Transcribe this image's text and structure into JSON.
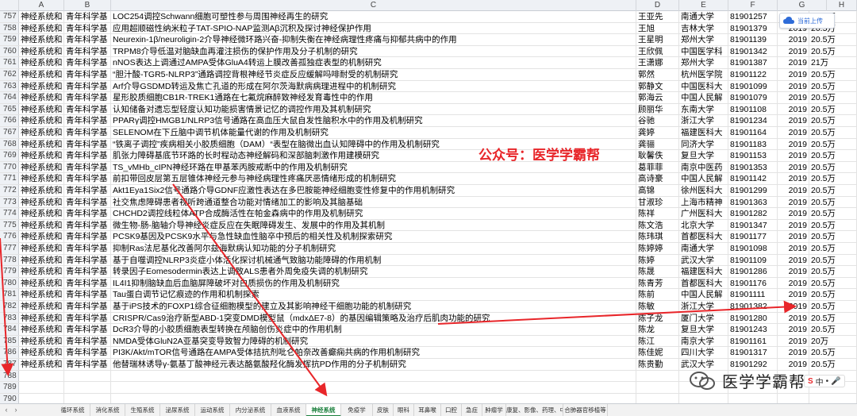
{
  "columns": [
    "A",
    "B",
    "C",
    "D",
    "E",
    "F",
    "G",
    "H"
  ],
  "rows": [
    {
      "n": "757",
      "a": "神经系统和",
      "b": "青年科学基",
      "c": "LOC254调控Schwann细胞可塑性参与周围神经再生的研究",
      "d": "王亚先",
      "e": "南通大学",
      "f": "81901257",
      "g": "2019",
      "h": "20.5万"
    },
    {
      "n": "758",
      "a": "神经系统和",
      "b": "青年科学基",
      "c": "应用超顺磁性纳米粒子TAT-SPIO-NAP监测Aβ沉积及探讨神经保护作用",
      "d": "王旭",
      "e": "吉林大学",
      "f": "81901379",
      "g": "2019",
      "h": "20.5万"
    },
    {
      "n": "759",
      "a": "神经系统和",
      "b": "青年科学基",
      "c": "Neurexin-1β/neuroligin-2介导神经微环路兴奋-抑制失衡在神经病理性疼痛与抑郁共病中的作用",
      "d": "王星明",
      "e": "郑州大学",
      "f": "81901139",
      "g": "2019",
      "h": "20.5万"
    },
    {
      "n": "760",
      "a": "神经系统和",
      "b": "青年科学基",
      "c": "TRPM8介导低温对脑缺血再灌注损伤的保护作用及分子机制的研究",
      "d": "王欣佩",
      "e": "中国医学科",
      "f": "81901342",
      "g": "2019",
      "h": "20.5万"
    },
    {
      "n": "761",
      "a": "神经系统和",
      "b": "青年科学基",
      "c": "nNOS表达上调通过AMPA受体GluA4转运上膜改善孤独症表型的机制研究",
      "d": "王潇娜",
      "e": "郑州大学",
      "f": "81901387",
      "g": "2019",
      "h": "21万"
    },
    {
      "n": "762",
      "a": "神经系统和",
      "b": "青年科学基",
      "c": "“胆汁酸-TGR5-NLRP3”通路调控背根神经节炎症反应缓解吗啡耐受的机制研究",
      "d": "郭然",
      "e": "杭州医学院",
      "f": "81901122",
      "g": "2019",
      "h": "20.5万"
    },
    {
      "n": "763",
      "a": "神经系统和",
      "b": "青年科学基",
      "c": "Arf介导GSDMD转运及焦亡孔道的形成在阿尔茨海默病病理进程中的机制研究",
      "d": "郭静文",
      "e": "中国医科大",
      "f": "81901099",
      "g": "2019",
      "h": "20.5万"
    },
    {
      "n": "764",
      "a": "神经系统和",
      "b": "青年科学基",
      "c": "星形胶质细胞CB1R-TREK1通路在七氟烷麻醉致神经发育毒性中的作用",
      "d": "郭海云",
      "e": "中国人民解",
      "f": "81901079",
      "g": "2019",
      "h": "20.5万"
    },
    {
      "n": "765",
      "a": "神经系统和",
      "b": "青年科学基",
      "c": "认知储备对遗忘型轻度认知功能损害情景记忆的调控作用及其机制研究",
      "d": "顾丽华",
      "e": "东南大学",
      "f": "81901108",
      "g": "2019",
      "h": "20.5万"
    },
    {
      "n": "766",
      "a": "神经系统和",
      "b": "青年科学基",
      "c": "PPARγ调控HMGB1/NLRP3信号通路在高血压大鼠自发性脑积水中的作用及机制研究",
      "d": "谷驰",
      "e": "浙江大学",
      "f": "81901234",
      "g": "2019",
      "h": "20.5万"
    },
    {
      "n": "767",
      "a": "神经系统和",
      "b": "青年科学基",
      "c": "SELENOM在下丘脑中调节机体能量代谢的作用及机制研究",
      "d": "龚婷",
      "e": "福建医科大",
      "f": "81901164",
      "g": "2019",
      "h": "20.5万"
    },
    {
      "n": "768",
      "a": "神经系统和",
      "b": "青年科学基",
      "c": "“铁离子调控”疾病相关小胶质细胞（DAM）“表型在脑微出血认知障碍中的作用及机制研究",
      "d": "龚骊",
      "e": "同济大学",
      "f": "81901183",
      "g": "2019",
      "h": "20.5万"
    },
    {
      "n": "769",
      "a": "神经系统和",
      "b": "青年科学基",
      "c": "肌张力障碍基底节环路的长时程动态神经解码和深部脑刺激作用建模研究",
      "d": "耿馨佚",
      "e": "复旦大学",
      "f": "81901153",
      "g": "2019",
      "h": "20.5万"
    },
    {
      "n": "770",
      "a": "神经系统和",
      "b": "青年科学基",
      "c": "TS_vMHb_cIPN神经环路在甲基苯丙胺戒断中的作用及机制研究",
      "d": "葛菲菲",
      "e": "南京中医药",
      "f": "81901353",
      "g": "2019",
      "h": "20.5万"
    },
    {
      "n": "771",
      "a": "神经系统和",
      "b": "青年科学基",
      "c": "前扣带回皮层第五层锥体神经元参与神经病理性疼痛厌恶情绪形成的机制研究",
      "d": "高诗豪",
      "e": "中国人民解",
      "f": "81901142",
      "g": "2019",
      "h": "20.5万"
    },
    {
      "n": "772",
      "a": "神经系统和",
      "b": "青年科学基",
      "c": "Akt1Eya1Six2信号通路介导GDNF应激性表达在多巴胺能神经细胞变性修复中的作用机制研究",
      "d": "高锦",
      "e": "徐州医科大",
      "f": "81901299",
      "g": "2019",
      "h": "20.5万"
    },
    {
      "n": "773",
      "a": "神经系统和",
      "b": "青年科学基",
      "c": "社交焦虑障碍患者视听跨通道整合功能对情绪加工的影响及其脑基础",
      "d": "甘淑珍",
      "e": "上海市精神",
      "f": "81901363",
      "g": "2019",
      "h": "20.5万"
    },
    {
      "n": "774",
      "a": "神经系统和",
      "b": "青年科学基",
      "c": "CHCHD2调控线粒体ATP合成酶活性在帕金森病中的作用及机制研究",
      "d": "陈祥",
      "e": "广州医科大",
      "f": "81901282",
      "g": "2019",
      "h": "20.5万"
    },
    {
      "n": "775",
      "a": "神经系统和",
      "b": "青年科学基",
      "c": "微生物-肠-脑轴介导神经炎症反应在失眠障碍发生、发展中的作用及其机制",
      "d": "陈文浩",
      "e": "北京大学",
      "f": "81901347",
      "g": "2019",
      "h": "20.5万"
    },
    {
      "n": "776",
      "a": "神经系统和",
      "b": "青年科学基",
      "c": "PCSK9基因及PCSK9水平与急性缺血性脑卒中预后的相关性及机制探索研究",
      "d": "陈玮琪",
      "e": "首都医科大",
      "f": "81901177",
      "g": "2019",
      "h": "20.5万"
    },
    {
      "n": "777",
      "a": "神经系统和",
      "b": "青年科学基",
      "c": "抑制Ras法尼基化改善阿尔兹海默病认知功能的分子机制研究",
      "d": "陈婷婷",
      "e": "南通大学",
      "f": "81901098",
      "g": "2019",
      "h": "20.5万"
    },
    {
      "n": "778",
      "a": "神经系统和",
      "b": "青年科学基",
      "c": "基于自噬调控NLRP3炎症小体活化探讨机械通气致脑功能障碍的作用机制",
      "d": "陈婷",
      "e": "武汉大学",
      "f": "81901109",
      "g": "2019",
      "h": "20.5万"
    },
    {
      "n": "779",
      "a": "神经系统和",
      "b": "青年科学基",
      "c": "转录因子Eomesodermin表达上调致ALS患者外周免疫失调的机制研究",
      "d": "陈晟",
      "e": "福建医科大",
      "f": "81901286",
      "g": "2019",
      "h": "20.5万"
    },
    {
      "n": "780",
      "a": "神经系统和",
      "b": "青年科学基",
      "c": "IL4I1抑制脑缺血后血脑屏障破坏对白质损伤的作用及机制研究",
      "d": "陈青芳",
      "e": "首都医科大",
      "f": "81901176",
      "g": "2019",
      "h": "20.5万"
    },
    {
      "n": "781",
      "a": "神经系统和",
      "b": "青年科学基",
      "c": "Tau蛋白调节记忆痕迹的作用和机制探索",
      "d": "陈前",
      "e": "中国人民解",
      "f": "81901111",
      "g": "2019",
      "h": "20.5万"
    },
    {
      "n": "782",
      "a": "神经系统和",
      "b": "青年科学基",
      "c": "基于iPS技术的FOXP1综合征细胞模型的建立及其影响神经干细胞功能的机制研究",
      "d": "陈敏",
      "e": "浙江大学",
      "f": "81901382",
      "g": "2019",
      "h": "20.5万"
    },
    {
      "n": "783",
      "a": "神经系统和",
      "b": "青年科学基",
      "c": "CRISPR/Cas9治疗新型ABD-1突变DMD模型鼠（mdxΔE7-8）的基因编辑策略及治疗后肌肉功能的研究",
      "d": "陈子龙",
      "e": "厦门大学",
      "f": "81901280",
      "g": "2019",
      "h": "20.5万"
    },
    {
      "n": "784",
      "a": "神经系统和",
      "b": "青年科学基",
      "c": "DcR3介导的小胶质细胞表型转换在颅脑创伤炎症中的作用机制",
      "d": "陈龙",
      "e": "复旦大学",
      "f": "81901243",
      "g": "2019",
      "h": "20.5万"
    },
    {
      "n": "785",
      "a": "神经系统和",
      "b": "青年科学基",
      "c": "NMDA受体GluN2A亚基突变导致智力障碍的机制研究",
      "d": "陈江",
      "e": "南京大学",
      "f": "81901161",
      "g": "2019",
      "h": "20万"
    },
    {
      "n": "786",
      "a": "神经系统和",
      "b": "青年科学基",
      "c": "PI3K/Akt/mTOR信号通路在AMPA受体拮抗剂吡仑帕奈改善癫痫共病的作用机制研究",
      "d": "陈佳妮",
      "e": "四川大学",
      "f": "81901317",
      "g": "2019",
      "h": "20.5万"
    },
    {
      "n": "787",
      "a": "神经系统和",
      "b": "青年科学基",
      "c": "他替瑞林诱导γ-氨基丁酸神经元表达酪氨酸羟化酶发挥抗PD作用的分子机制研究",
      "d": "陈贵勤",
      "e": "武汉大学",
      "f": "81901292",
      "g": "2019",
      "h": "20.5万"
    },
    {
      "n": "788",
      "a": "",
      "b": "",
      "c": "",
      "d": "",
      "e": "",
      "f": "",
      "g": "",
      "h": ""
    },
    {
      "n": "789",
      "a": "",
      "b": "",
      "c": "",
      "d": "",
      "e": "",
      "f": "",
      "g": "",
      "h": ""
    },
    {
      "n": "790",
      "a": "",
      "b": "",
      "c": "",
      "d": "",
      "e": "",
      "f": "",
      "g": "",
      "h": ""
    },
    {
      "n": "791",
      "a": "",
      "b": "",
      "c": "",
      "d": "",
      "e": "",
      "f": "",
      "g": "",
      "h": ""
    }
  ],
  "sheet_tabs": [
    "循环系统",
    "消化系统",
    "生殖系统",
    "泌尿系统",
    "运动系统",
    "内分泌系统",
    "血液系统",
    "神经系统",
    "免疫学",
    "皮肤",
    "眼科",
    "耳鼻喉",
    "口腔",
    "急症",
    "肿瘤学",
    "康复、影像、药理、中医",
    "合肺器官移植等"
  ],
  "active_tab": "神经系统",
  "watermark": "公众号：医学学霸帮",
  "brand": "医学学霸帮",
  "cloud_badge": "当前上传",
  "ime_label": "中",
  "colors": {
    "accent": "#1a7f3c",
    "arrow": "#e8262a"
  }
}
